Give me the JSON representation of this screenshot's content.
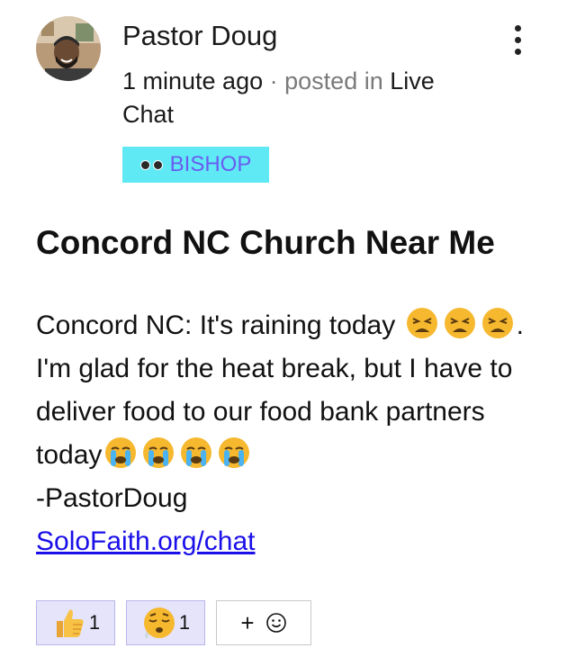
{
  "author": {
    "name": "Pastor Doug",
    "time": "1 minute ago",
    "separator": "·",
    "posted_in_label": "posted in",
    "channel": "Live Chat"
  },
  "badge": {
    "label": "BISHOP",
    "icon": "eyes-icon"
  },
  "post": {
    "title": "Concord NC Church Near Me",
    "text_part1": "Concord NC: It's raining today",
    "text_part2": ". I'm glad for the heat break, but I have to deliver food to our food bank partners today",
    "signature": "-PastorDoug",
    "link": "SoloFaith.org/chat"
  },
  "reactions": [
    {
      "icon": "thumbs-up-icon",
      "count": "1"
    },
    {
      "icon": "sleepy-face-icon",
      "count": "1"
    }
  ],
  "add_reaction": {
    "plus": "+",
    "icon": "smiley-icon"
  },
  "colors": {
    "badge_bg": "#5fe9f5",
    "badge_text": "#6a5cf0",
    "link": "#1a0fe8",
    "reaction_active_bg": "#e5e4fb"
  }
}
